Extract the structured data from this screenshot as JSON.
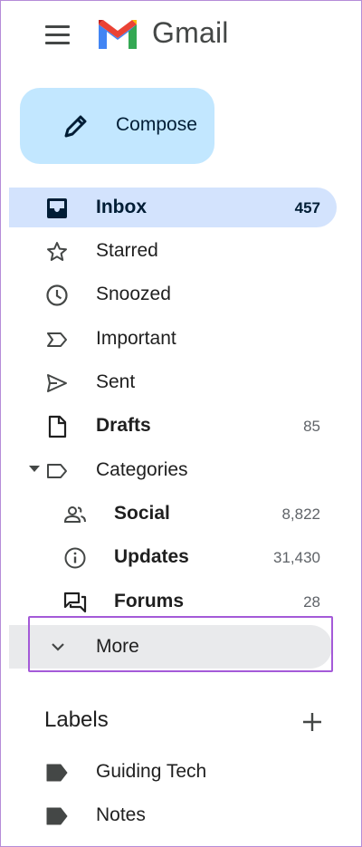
{
  "app": {
    "title": "Gmail"
  },
  "compose": {
    "label": "Compose"
  },
  "nav": [
    {
      "label": "Inbox",
      "count": "457",
      "icon": "inbox-icon",
      "active": true
    },
    {
      "label": "Starred",
      "count": "",
      "icon": "star-icon"
    },
    {
      "label": "Snoozed",
      "count": "",
      "icon": "clock-icon"
    },
    {
      "label": "Important",
      "count": "",
      "icon": "important-icon"
    },
    {
      "label": "Sent",
      "count": "",
      "icon": "send-icon"
    },
    {
      "label": "Drafts",
      "count": "85",
      "icon": "draft-icon"
    },
    {
      "label": "Categories",
      "count": "",
      "icon": "label-outline-icon"
    }
  ],
  "categories": [
    {
      "label": "Social",
      "count": "8,822",
      "icon": "people-icon"
    },
    {
      "label": "Updates",
      "count": "31,430",
      "icon": "info-icon"
    },
    {
      "label": "Forums",
      "count": "28",
      "icon": "forum-icon"
    }
  ],
  "more": {
    "label": "More"
  },
  "labels": {
    "title": "Labels",
    "items": [
      {
        "label": "Guiding Tech",
        "icon": "label-icon"
      },
      {
        "label": "Notes",
        "icon": "label-icon"
      }
    ]
  },
  "colors": {
    "compose_bg": "#c2e7ff",
    "active_bg": "#d3e3fd",
    "more_bg": "#e9eaec",
    "highlight_border": "#a45ad8",
    "icon": "#444746"
  }
}
